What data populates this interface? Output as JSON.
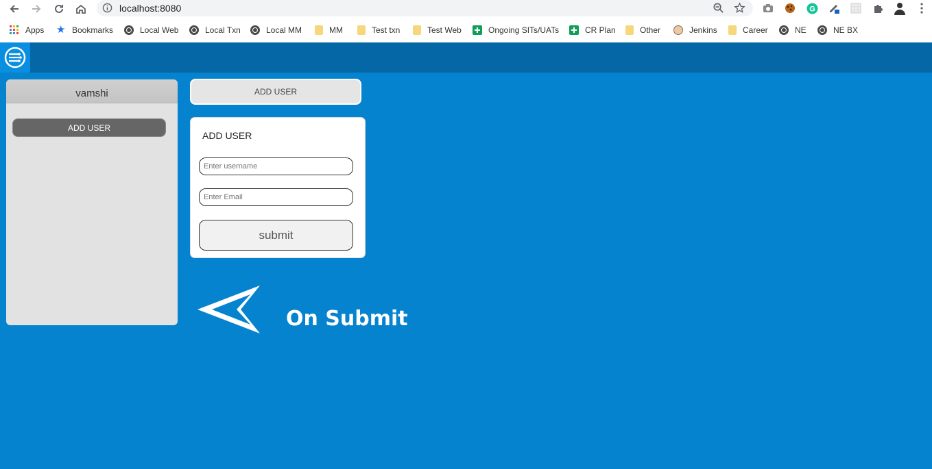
{
  "browser": {
    "url": "localhost:8080",
    "bookmarks": [
      {
        "label": "Apps",
        "icon": "apps-grid-icon"
      },
      {
        "label": "Bookmarks",
        "icon": "star-icon"
      },
      {
        "label": "Local Web",
        "icon": "globe-icon"
      },
      {
        "label": "Local Txn",
        "icon": "globe-icon"
      },
      {
        "label": "Local MM",
        "icon": "globe-icon"
      },
      {
        "label": "MM",
        "icon": "folder-icon"
      },
      {
        "label": "Test txn",
        "icon": "folder-icon"
      },
      {
        "label": "Test Web",
        "icon": "folder-icon"
      },
      {
        "label": "Ongoing SITs/UATs",
        "icon": "sheets-icon"
      },
      {
        "label": "CR Plan",
        "icon": "sheets-icon"
      },
      {
        "label": "Other",
        "icon": "folder-icon"
      },
      {
        "label": "Jenkins",
        "icon": "jenkins-icon"
      },
      {
        "label": "Career",
        "icon": "folder-icon"
      },
      {
        "label": "NE",
        "icon": "globe-icon"
      },
      {
        "label": "NE BX",
        "icon": "globe-icon"
      }
    ]
  },
  "app": {
    "colors": {
      "header": "#0567a6",
      "background": "#0683cf",
      "sidebar": "#e2e2e2"
    },
    "sidebar": {
      "username": "vamshi",
      "add_user_label": "ADD USER"
    },
    "top_button_label": "ADD USER",
    "form": {
      "title": "ADD USER",
      "username_placeholder": "Enter username",
      "email_placeholder": "Enter Email",
      "submit_label": "submit"
    },
    "annotation": "On Submit"
  }
}
